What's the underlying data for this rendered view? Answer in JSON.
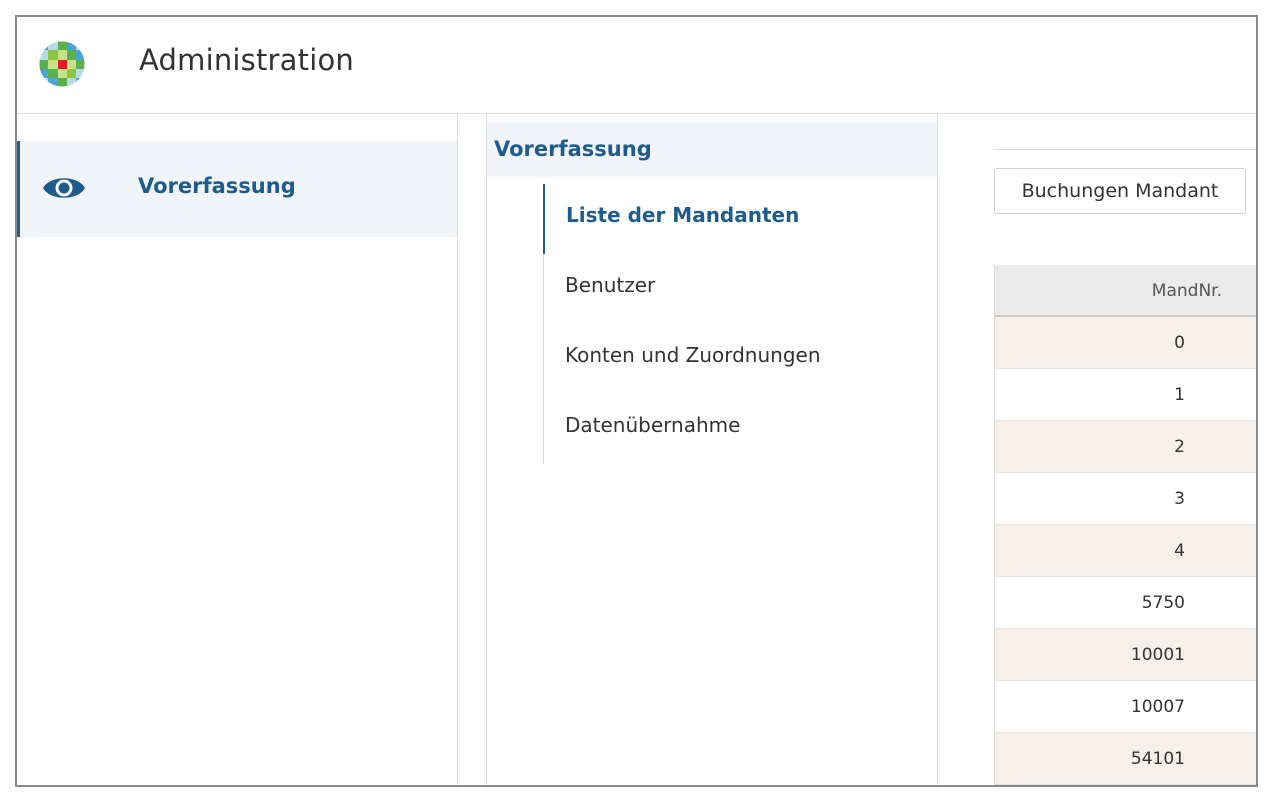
{
  "header": {
    "title": "Administration",
    "logo_icon": "wolters-kluwer-logo-icon"
  },
  "sidebar": {
    "items": [
      {
        "label": "Vorerfassung",
        "icon": "eye-icon",
        "active": true
      }
    ]
  },
  "midnav": {
    "heading": "Vorerfassung",
    "items": [
      {
        "label": "Liste der Mandanten",
        "active": true
      },
      {
        "label": "Benutzer",
        "active": false
      },
      {
        "label": "Konten und Zuordnungen",
        "active": false
      },
      {
        "label": "Datenübernahme",
        "active": false
      }
    ]
  },
  "content": {
    "button_label": "Buchungen Mandant",
    "table": {
      "columns": [
        "MandNr."
      ],
      "rows": [
        "0",
        "1",
        "2",
        "3",
        "4",
        "5750",
        "10001",
        "10007",
        "54101"
      ]
    }
  },
  "colors": {
    "accent": "#1d5c8c",
    "row_alt": "#f7efea",
    "nav_active_bg": "#f1f5f9"
  }
}
